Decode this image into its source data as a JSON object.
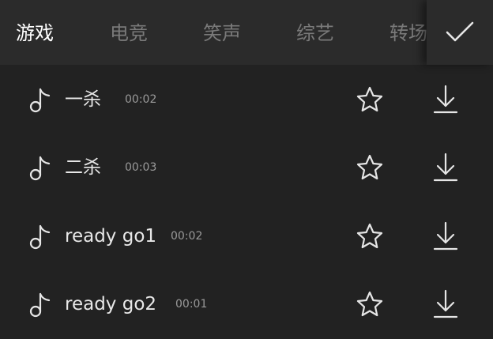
{
  "tabs": [
    {
      "label": "游戏",
      "active": true
    },
    {
      "label": "电竞",
      "active": false
    },
    {
      "label": "笑声",
      "active": false
    },
    {
      "label": "综艺",
      "active": false
    },
    {
      "label": "转场",
      "active": false
    }
  ],
  "confirm_icon": "checkmark-icon",
  "sounds": [
    {
      "name": "一杀",
      "duration": "00:02"
    },
    {
      "name": "二杀",
      "duration": "00:03"
    },
    {
      "name": "ready go1",
      "duration": "00:02"
    },
    {
      "name": "ready go2",
      "duration": "00:01"
    }
  ],
  "icons": {
    "sound": "music-note-icon",
    "favorite": "star-icon",
    "download": "download-icon"
  },
  "colors": {
    "background": "#222222",
    "header": "#2b2b2b",
    "active_tab": "#ffffff",
    "inactive_tab": "#7a7a7a"
  }
}
